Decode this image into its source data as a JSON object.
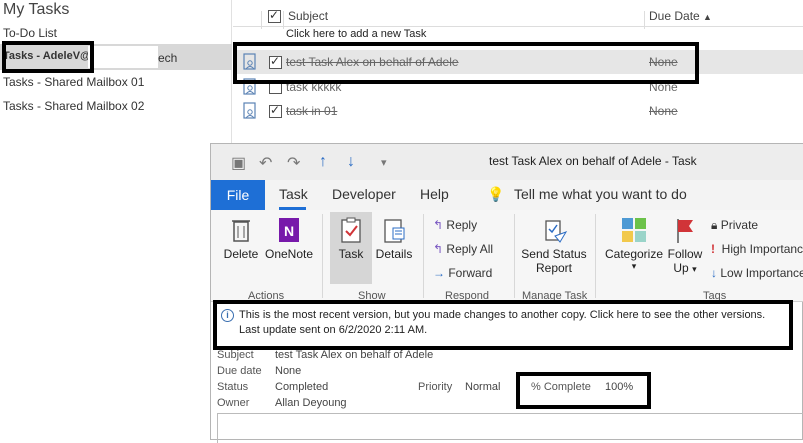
{
  "nav": {
    "title": "My Tasks",
    "items": [
      "To-Do List",
      "Tasks - AdeleV@",
      "ech",
      "Tasks - Shared Mailbox 01",
      "Tasks - Shared Mailbox 02"
    ]
  },
  "list": {
    "headers": {
      "subject": "Subject",
      "due_date": "Due Date"
    },
    "new_task_prompt": "Click here to add a new Task",
    "rows": [
      {
        "subject": "test Task Alex on behalf of Adele",
        "due": "None",
        "done": true
      },
      {
        "subject": "task kkkkk",
        "due": "None",
        "done": false
      },
      {
        "subject": "task in 01",
        "due": "None",
        "done": true
      }
    ]
  },
  "window": {
    "title": "test Task Alex on behalf of Adele  -  Task",
    "tabs": [
      "File",
      "Task",
      "Developer",
      "Help"
    ],
    "tell_me": "Tell me what you want to do",
    "ribbon": {
      "delete": "Delete",
      "onenote": "OneNote",
      "task": "Task",
      "details": "Details",
      "reply": "Reply",
      "reply_all": "Reply All",
      "forward": "Forward",
      "send_status_1": "Send Status",
      "send_status_2": "Report",
      "categorize": "Categorize",
      "follow_1": "Follow",
      "follow_2": "Up",
      "private": "Private",
      "high": "High Importance",
      "low": "Low Importance",
      "groups": [
        "Actions",
        "Show",
        "Respond",
        "Manage Task",
        "Tags"
      ]
    },
    "info": {
      "line1": "This is the most recent version, but you made changes to another copy. Click here to see the other versions.",
      "line2": "Last update sent on 6/2/2020 2:11 AM."
    },
    "fields": {
      "subject_label": "Subject",
      "subject": "test Task Alex on behalf of Adele",
      "due_label": "Due date",
      "due": "None",
      "status_label": "Status",
      "status": "Completed",
      "priority_label": "Priority",
      "priority": "Normal",
      "complete_label": "% Complete",
      "complete": "100%",
      "owner_label": "Owner",
      "owner": "Allan Deyoung"
    }
  },
  "colors": {
    "accent": "#1e6fd6",
    "highlight_box": "#000000"
  }
}
